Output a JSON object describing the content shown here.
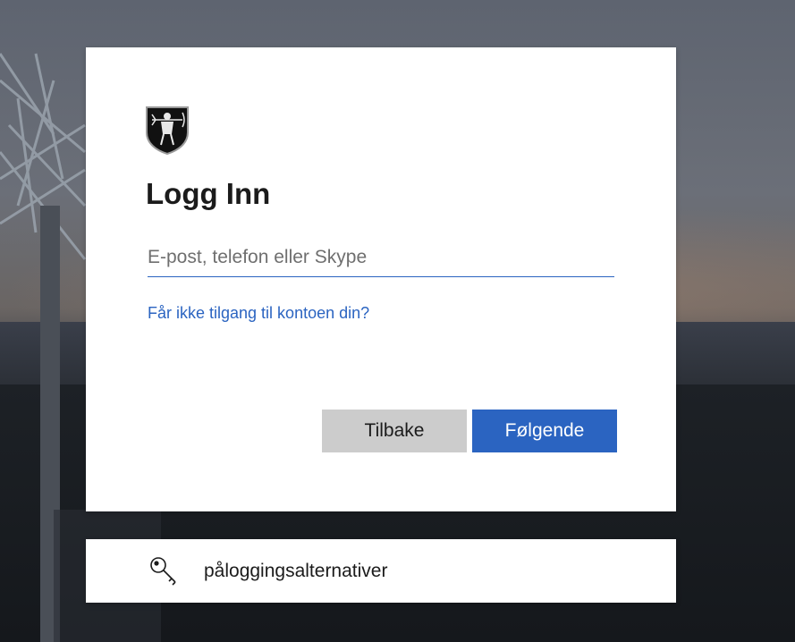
{
  "login": {
    "title": "Logg Inn",
    "email_placeholder": "E-post, telefon eller Skype",
    "email_value": "",
    "help_link": "Får ikke tilgang til kontoen din?",
    "back_button": "Tilbake",
    "next_button": "Følgende"
  },
  "sign_in_options": {
    "label": "påloggingsalternativer",
    "icon": "key-icon"
  },
  "colors": {
    "accent": "#2b64c1",
    "secondary_button": "#cccccc",
    "card": "#ffffff"
  }
}
